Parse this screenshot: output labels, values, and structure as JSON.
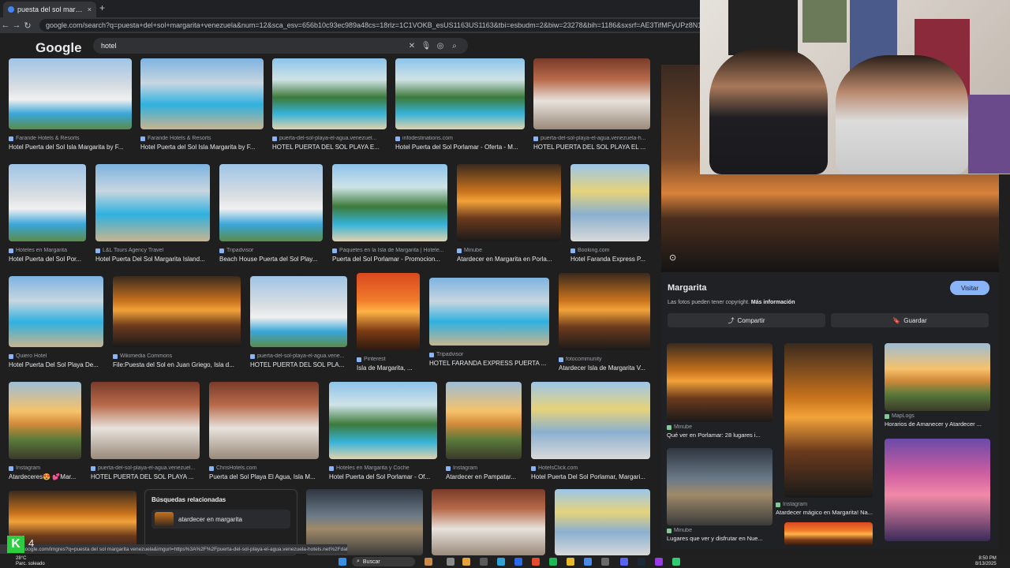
{
  "browser": {
    "tab_title": "puesta del sol margarita venez...",
    "tab_close": "×",
    "new_tab": "+",
    "url": "google.com/search?q=puesta+del+sol+margarita+venezuela&num=12&sca_esv=656b10c93ec989a48cs=18rlz=1C1VOKB_esUS1163US1163&tbi=esbudm=2&biw=23278&bih=1186&sxsrf=AE3TifMFyUPz8N1o85D6VYE6DYaqUsCw%3A1755132549176&ei=bH"
  },
  "google": {
    "logo": "Google",
    "query": "hotel"
  },
  "results": [
    {
      "source": "Farande Hotels & Resorts",
      "caption": "Hotel Puerta del Sol Isla Margarita by F..."
    },
    {
      "source": "Farande Hotels & Resorts",
      "caption": "Hotel Puerta del Sol Isla Margarita by F..."
    },
    {
      "source": "puerta-del-sol-playa-el-agua.venezuel...",
      "caption": "HOTEL PUERTA DEL SOL PLAYA E..."
    },
    {
      "source": "infodestinations.com",
      "caption": "Hotel Puerta del Sol Porlamar - Oferta - M..."
    },
    {
      "source": "puerta-del-sol-playa-el-agua.venezuela-h...",
      "caption": "HOTEL PUERTA DEL SOL PLAYA EL ..."
    },
    {
      "source": "Hoteles en Margarita",
      "caption": "Hotel Puerta del Sol Por..."
    },
    {
      "source": "L&L Tours Agency Travel",
      "caption": "Hotel Puerta Del Sol Margarita Island..."
    },
    {
      "source": "Tripadvisor",
      "caption": "Beach House Puerta del Sol Play..."
    },
    {
      "source": "Paquetes en la Isla de Margarita | Hotele...",
      "caption": "Puerta del Sol Porlamar - Promocion..."
    },
    {
      "source": "Minube",
      "caption": "Atardecer en Margarita en Porla..."
    },
    {
      "source": "Booking.com",
      "caption": "Hotel Faranda Express P..."
    },
    {
      "source": "Quiero Hotel",
      "caption": "Hotel Puerta Del Sol Playa De..."
    },
    {
      "source": "Wikimedia Commons",
      "caption": "File:Puesta del Sol en Juan Griego, Isla d..."
    },
    {
      "source": "puerta-del-sol-playa-el-agua.vene...",
      "caption": "HOTEL PUERTA DEL SOL PLA..."
    },
    {
      "source": "Pinterest",
      "caption": "Isla de Margarita, ..."
    },
    {
      "source": "Tripadvisor",
      "caption": "HOTEL FARANDA EXPRESS PUERTA ..."
    },
    {
      "source": "fotocommunity",
      "caption": "Atardecer Isla de Margarita V..."
    },
    {
      "source": "Instagram",
      "caption": "Atardeceres😍 💕Mar..."
    },
    {
      "source": "puerta-del-sol-playa-el-agua.venezuel...",
      "caption": "HOTEL PUERTA DEL SOL PLAYA ..."
    },
    {
      "source": "ChrisHotels.com",
      "caption": "Puerta del Sol Playa El Agua, Isla M..."
    },
    {
      "source": "Hoteles en Margarita y Coche",
      "caption": "Hotel Puerta del Sol Porlamar - Of..."
    },
    {
      "source": "Instagram",
      "caption": "Atardecer en Pampatar..."
    },
    {
      "source": "HotelsClick.com",
      "caption": "Hotel Puerta Del Sol Porlamar, Margari..."
    }
  ],
  "related": {
    "title": "Búsquedas relacionadas",
    "item": "atardecer en margarita"
  },
  "panel": {
    "title": "Margarita",
    "visit": "Visitar",
    "copyright": "Las fotos pueden tener copyright.",
    "more_info": "Más información",
    "share": "Compartir",
    "save": "Guardar",
    "items": [
      {
        "source": "Minube",
        "caption": "Qué ver en Porlamar: 28 lugares i..."
      },
      {
        "source": "MapLogs",
        "caption": "Horarios de Amanecer y Atardecer ..."
      },
      {
        "source": "Instagram",
        "caption": "Atardecer mágico en Margarita! Na..."
      },
      {
        "source": "Minube",
        "caption": "Lugares que ver y disfrutar en Nue..."
      }
    ]
  },
  "status": {
    "url": "google.com/imgres?q=puesta del sol margarita venezuela&imgurl=https%3A%2F%2Fpuerta-del-sol-playa-el-agua.venezuela-hotels.net%2Fdat...",
    "badge": "K",
    "badge_count": "4"
  },
  "taskbar": {
    "temp": "28°C",
    "weather": "Parc. soleado",
    "search": "Buscar",
    "time": "8:50 PM",
    "date": "8/13/2025"
  },
  "colors": {
    "accent": "#8ab4f8",
    "badge": "#2ecc40",
    "bg": "#1f1f1f"
  }
}
